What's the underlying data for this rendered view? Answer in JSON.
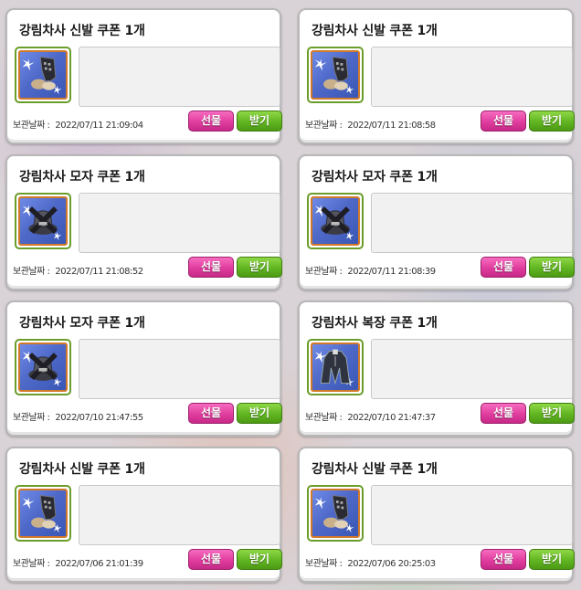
{
  "date_label": "보관날짜 :",
  "buttons": {
    "gift": "선물",
    "receive": "받기"
  },
  "coupons": [
    {
      "title": "강림차사 신발 쿠폰 1개",
      "date": "2022/07/11 21:09:04",
      "item_icon": "shoes-icon"
    },
    {
      "title": "강림차사 신발 쿠폰 1개",
      "date": "2022/07/11 21:08:58",
      "item_icon": "shoes-icon"
    },
    {
      "title": "강림차사 모자 쿠폰 1개",
      "date": "2022/07/11 21:08:52",
      "item_icon": "hat-icon"
    },
    {
      "title": "강림차사 모자 쿠폰 1개",
      "date": "2022/07/11 21:08:39",
      "item_icon": "hat-icon"
    },
    {
      "title": "강림차사 모자 쿠폰 1개",
      "date": "2022/07/10 21:47:55",
      "item_icon": "hat-icon"
    },
    {
      "title": "강림차사 복장 쿠폰 1개",
      "date": "2022/07/10 21:47:37",
      "item_icon": "outfit-icon"
    },
    {
      "title": "강림차사 신발 쿠폰 1개",
      "date": "2022/07/06 21:01:39",
      "item_icon": "shoes-icon"
    },
    {
      "title": "강림차사 신발 쿠폰 1개",
      "date": "2022/07/06 20:25:03",
      "item_icon": "shoes-icon"
    }
  ],
  "colors": {
    "gift_button": "#e03d9e",
    "receive_button": "#61b521",
    "thumb_border": "#6a9d2a",
    "thumb_background": "#4f69c9"
  }
}
